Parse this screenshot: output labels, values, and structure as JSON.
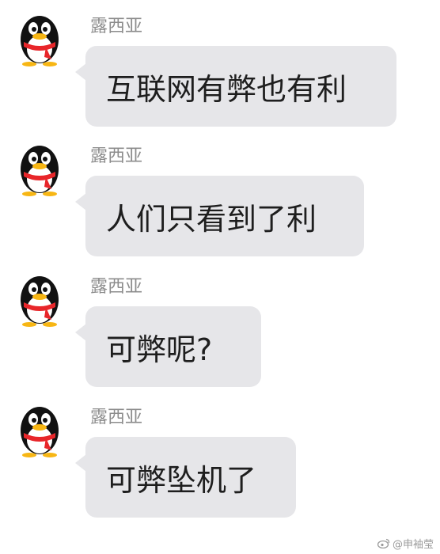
{
  "messages": [
    {
      "sender": "露西亚",
      "text": "互联网有弊也有利",
      "avatar": "qq-penguin-icon"
    },
    {
      "sender": "露西亚",
      "text": "人们只看到了利",
      "avatar": "qq-penguin-icon"
    },
    {
      "sender": "露西亚",
      "text": "可弊呢?",
      "avatar": "qq-penguin-icon"
    },
    {
      "sender": "露西亚",
      "text": "可弊坠机了",
      "avatar": "qq-penguin-icon"
    }
  ],
  "watermark": {
    "icon": "weibo-icon",
    "text": "@申袖莹"
  },
  "colors": {
    "bubble": "#e6e6e9",
    "name": "#8c8c8c",
    "text": "#1e1e1e",
    "scarf": "#e8262a",
    "beak": "#f7b614"
  }
}
